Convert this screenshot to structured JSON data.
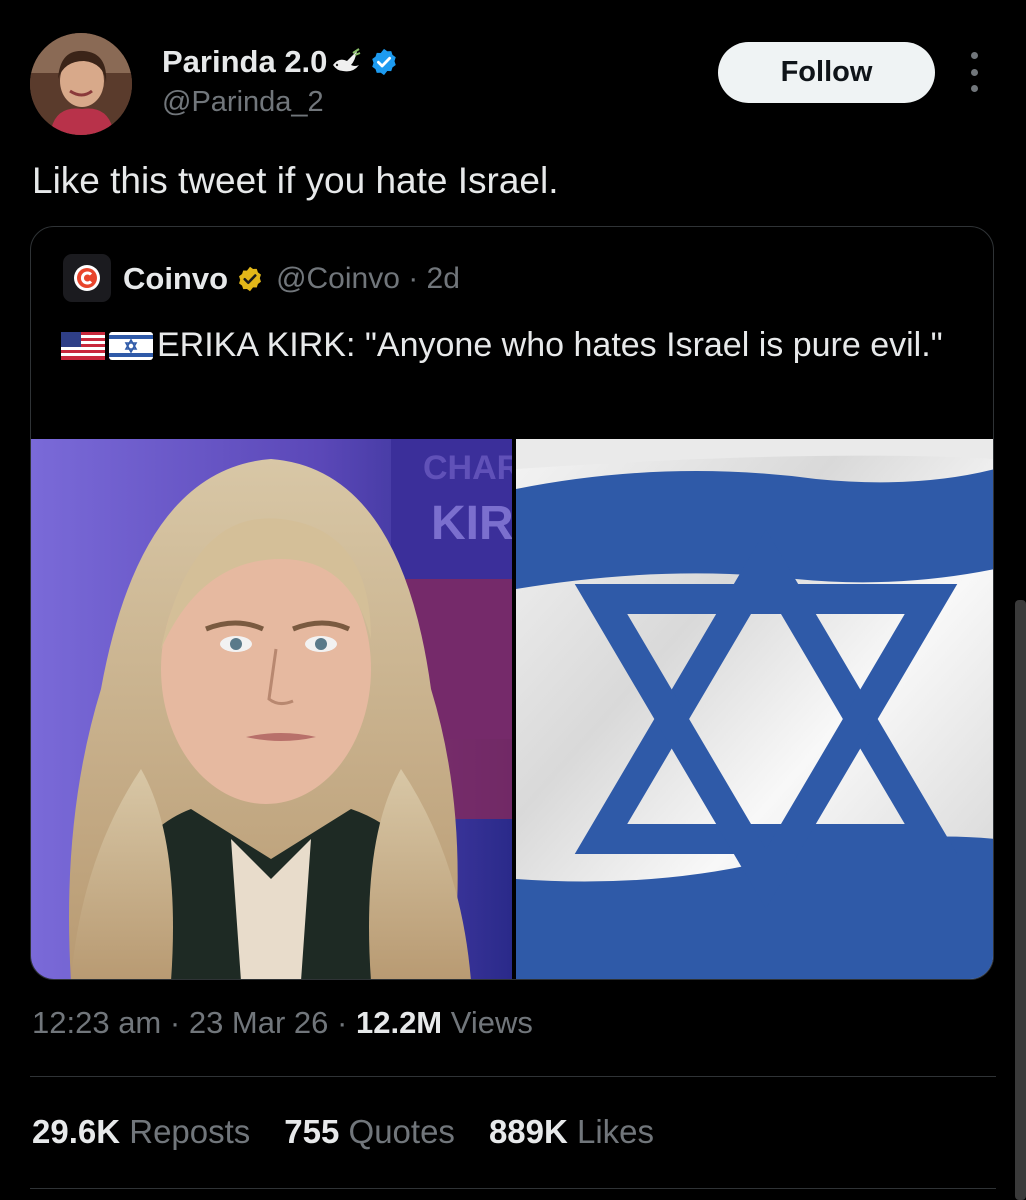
{
  "author": {
    "display_name": "Parinda 2.0",
    "handle": "@Parinda_2",
    "follow_label": "Follow"
  },
  "tweet": {
    "text": "Like this tweet if you hate Israel."
  },
  "quoted": {
    "name": "Coinvo",
    "handle_time": "@Coinvo · 2d",
    "text": "ERIKA KIRK: \"Anyone who hates Israel is pure evil.\"",
    "background_sign_text": "CHAR KIR"
  },
  "meta": {
    "time": "12:23 am",
    "date": "23 Mar 26",
    "views_count": "12.2M",
    "views_label": "Views"
  },
  "stats": [
    {
      "count": "29.6K",
      "label": "Reposts"
    },
    {
      "count": "755",
      "label": "Quotes"
    },
    {
      "count": "889K",
      "label": "Likes"
    }
  ],
  "colors": {
    "background": "#000000",
    "text_primary": "#e7e9ea",
    "text_secondary": "#71767b",
    "border": "#2f3336",
    "verified_blue": "#1d9bf0",
    "verified_gold": "#e2b719",
    "flag_blue": "#2f5aa8"
  }
}
